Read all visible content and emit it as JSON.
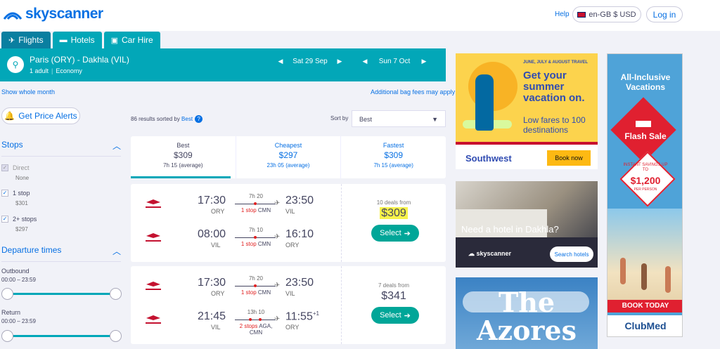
{
  "header": {
    "logo": "skyscanner",
    "help": "Help",
    "locale": "en-GB $ USD",
    "login": "Log in"
  },
  "tabs": [
    {
      "label": "Flights",
      "icon": "plane-icon"
    },
    {
      "label": "Hotels",
      "icon": "bed-icon"
    },
    {
      "label": "Car Hire",
      "icon": "car-icon"
    }
  ],
  "search": {
    "route": "Paris (ORY) - Dakhla (VIL)",
    "adults": "1 adult",
    "cabin": "Economy",
    "depart": "Sat 29 Sep",
    "return": "Sun 7 Oct"
  },
  "links": {
    "show_month": "Show whole month",
    "bag_fees": "Additional bag fees may apply"
  },
  "alerts": {
    "label": "Get Price Alerts"
  },
  "filters": {
    "stops_title": "Stops",
    "direct": {
      "label": "Direct",
      "sub": "None",
      "checked": false
    },
    "one_stop": {
      "label": "1 stop",
      "sub": "$301",
      "checked": true
    },
    "two_stops": {
      "label": "2+ stops",
      "sub": "$297",
      "checked": true
    },
    "dep_title": "Departure times",
    "outbound": {
      "label": "Outbound",
      "range": "00:00 – 23:59"
    },
    "return": {
      "label": "Return",
      "range": "00:00 – 23:59"
    }
  },
  "results": {
    "count_text": "86 results sorted by ",
    "sorted_by": "Best",
    "sort_label": "Sort by",
    "sort_value": "Best"
  },
  "summary": [
    {
      "title": "Best",
      "price": "$309",
      "dur": "7h 15 (average)"
    },
    {
      "title": "Cheapest",
      "price": "$297",
      "dur": "23h 05 (average)"
    },
    {
      "title": "Fastest",
      "price": "$309",
      "dur": "7h 15 (average)"
    }
  ],
  "cards": [
    {
      "deals": "10 deals from",
      "price": "$309",
      "select": "Select",
      "out": {
        "dep": "17:30",
        "dep_ap": "ORY",
        "dur": "7h 20",
        "stops": "1 stop",
        "via": "CMN",
        "arr": "23:50",
        "arr_ap": "VIL"
      },
      "ret": {
        "dep": "08:00",
        "dep_ap": "VIL",
        "dur": "7h 10",
        "stops": "1 stop",
        "via": "CMN",
        "arr": "16:10",
        "arr_ap": "ORY"
      }
    },
    {
      "deals": "7 deals from",
      "price": "$341",
      "select": "Select",
      "out": {
        "dep": "17:30",
        "dep_ap": "ORY",
        "dur": "7h 20",
        "stops": "1 stop",
        "via": "CMN",
        "arr": "23:50",
        "arr_ap": "VIL"
      },
      "ret": {
        "dep": "21:45",
        "dep_ap": "VIL",
        "dur": "13h 10",
        "stops": "2 stops",
        "via": "AGA, CMN",
        "arr": "11:55",
        "arr_sup": "+1",
        "arr_ap": "ORY"
      }
    }
  ],
  "ads": {
    "southwest": {
      "tag": "JUNE, JULY & AUGUST TRAVEL",
      "head": "Get your summer vacation on.",
      "sub": "Low fares to 100 destinations",
      "logo": "Southwest",
      "btn": "Book now"
    },
    "hotel": {
      "title": "Need a hotel in Dakhla?",
      "logo": "skyscanner",
      "btn": "Search hotels"
    },
    "azores": {
      "title": "The Azores"
    },
    "clubmed": {
      "head": "All-Inclusive Vacations",
      "flash": "Flash Sale",
      "save": "INSTANT SAVINGS UP TO",
      "amount": "$1,200",
      "per": "PER PERSON",
      "book": "BOOK TODAY",
      "logo": "ClubMed"
    }
  }
}
